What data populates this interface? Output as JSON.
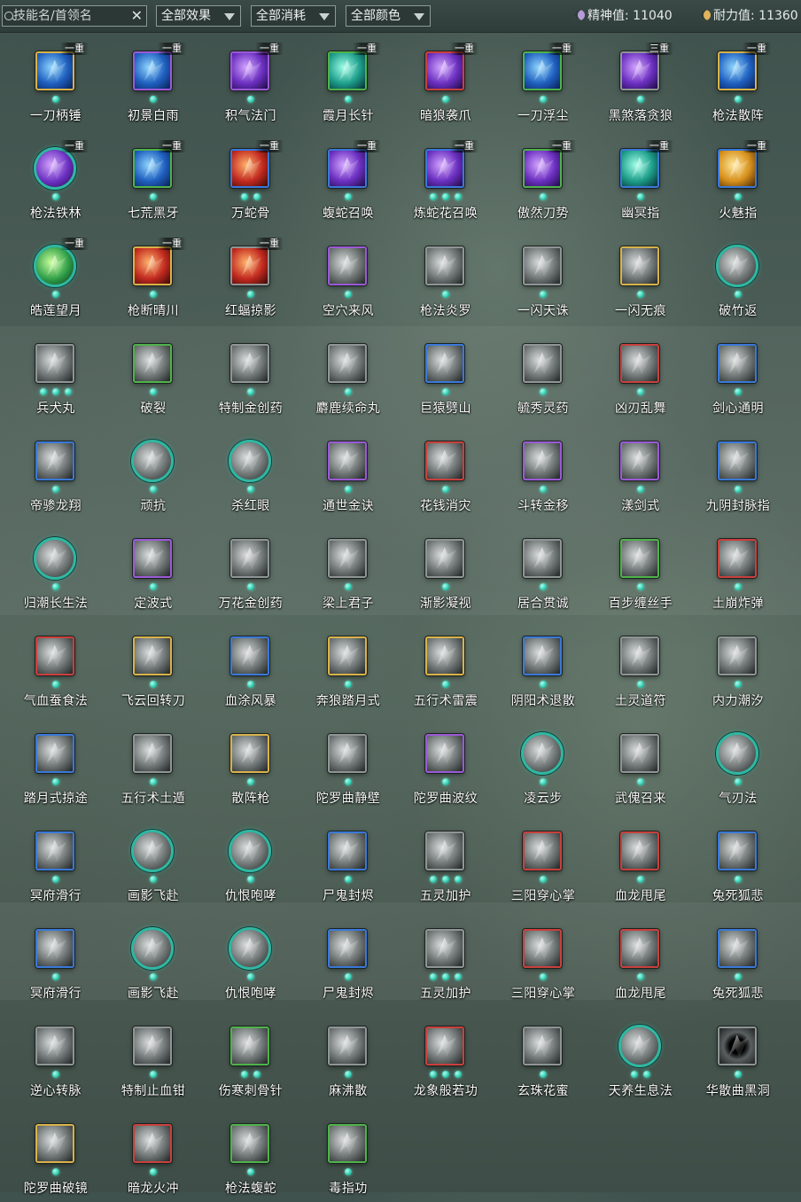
{
  "toolbar": {
    "search_placeholder": "技能名/首领名",
    "search_clear": "✕",
    "filters": [
      "全部效果",
      "全部消耗",
      "全部颜色"
    ],
    "stats": [
      {
        "label": "精神值: 11040",
        "icon": "spirit-moon-icon"
      },
      {
        "label": "耐力值: 11360",
        "icon": "stamina-moon-icon"
      }
    ]
  },
  "skills": [
    {
      "name": "一刀柄锤",
      "level": "一重",
      "dots": 1,
      "border": "gold",
      "palette": "blue",
      "shape": "square"
    },
    {
      "name": "初景白雨",
      "level": "一重",
      "dots": 1,
      "border": "purple",
      "palette": "blue",
      "shape": "square"
    },
    {
      "name": "积气法门",
      "level": "一重",
      "dots": 1,
      "border": "purple",
      "palette": "violet",
      "shape": "square"
    },
    {
      "name": "霞月长针",
      "level": "一重",
      "dots": 1,
      "border": "green",
      "palette": "cyan",
      "shape": "square"
    },
    {
      "name": "暗狼袭爪",
      "level": "一重",
      "dots": 1,
      "border": "red",
      "palette": "violet",
      "shape": "square"
    },
    {
      "name": "一刀浮尘",
      "level": "一重",
      "dots": 1,
      "border": "green",
      "palette": "blue",
      "shape": "square"
    },
    {
      "name": "黑煞落贪狼",
      "level": "三重",
      "dots": 1,
      "border": "gray",
      "palette": "violet",
      "shape": "square"
    },
    {
      "name": "枪法散阵",
      "level": "一重",
      "dots": 1,
      "border": "gold",
      "palette": "blue",
      "shape": "square"
    },
    {
      "name": "枪法铁林",
      "level": "一重",
      "dots": 1,
      "border": "round",
      "palette": "violet",
      "shape": "round"
    },
    {
      "name": "七荒黑牙",
      "level": "一重",
      "dots": 1,
      "border": "green",
      "palette": "blue",
      "shape": "square"
    },
    {
      "name": "万蛇骨",
      "level": "一重",
      "dots": 2,
      "border": "blue",
      "palette": "red",
      "shape": "square"
    },
    {
      "name": "蝮蛇召唤",
      "level": "一重",
      "dots": 1,
      "border": "blue",
      "palette": "violet",
      "shape": "square"
    },
    {
      "name": "炼蛇花召唤",
      "level": "一重",
      "dots": 3,
      "border": "blue",
      "palette": "violet",
      "shape": "square"
    },
    {
      "name": "傲然刀势",
      "level": "一重",
      "dots": 1,
      "border": "green",
      "palette": "violet",
      "shape": "square"
    },
    {
      "name": "幽冥指",
      "level": "一重",
      "dots": 1,
      "border": "blue",
      "palette": "cyan",
      "shape": "square"
    },
    {
      "name": "火魅指",
      "level": "一重",
      "dots": 1,
      "border": "blue",
      "palette": "gold",
      "shape": "square"
    },
    {
      "name": "皓莲望月",
      "level": "一重",
      "dots": 1,
      "border": "round",
      "palette": "green",
      "shape": "round"
    },
    {
      "name": "枪断晴川",
      "level": "一重",
      "dots": 1,
      "border": "gold",
      "palette": "red",
      "shape": "square"
    },
    {
      "name": "红蝠掠影",
      "level": "一重",
      "dots": 1,
      "border": "gray",
      "palette": "red",
      "shape": "square"
    },
    {
      "name": "空穴来风",
      "level": "",
      "dots": 1,
      "border": "purple",
      "palette": "gray",
      "shape": "square"
    },
    {
      "name": "枪法炎罗",
      "level": "",
      "dots": 1,
      "border": "gray",
      "palette": "gray",
      "shape": "square"
    },
    {
      "name": "一闪天诛",
      "level": "",
      "dots": 1,
      "border": "gray",
      "palette": "gray",
      "shape": "square"
    },
    {
      "name": "一闪无痕",
      "level": "",
      "dots": 1,
      "border": "gold",
      "palette": "gray",
      "shape": "square"
    },
    {
      "name": "破竹返",
      "level": "",
      "dots": 1,
      "border": "round",
      "palette": "gray",
      "shape": "round"
    },
    {
      "name": "兵犬丸",
      "level": "",
      "dots": 3,
      "border": "gray",
      "palette": "gray",
      "shape": "square"
    },
    {
      "name": "破裂",
      "level": "",
      "dots": 1,
      "border": "green",
      "palette": "gray",
      "shape": "square"
    },
    {
      "name": "特制金创药",
      "level": "",
      "dots": 1,
      "border": "gray",
      "palette": "gray",
      "shape": "square"
    },
    {
      "name": "麝鹿续命丸",
      "level": "",
      "dots": 1,
      "border": "gray",
      "palette": "gray",
      "shape": "square"
    },
    {
      "name": "巨猿劈山",
      "level": "",
      "dots": 1,
      "border": "blue",
      "palette": "gray",
      "shape": "square"
    },
    {
      "name": "毓秀灵药",
      "level": "",
      "dots": 1,
      "border": "gray",
      "palette": "gray",
      "shape": "square"
    },
    {
      "name": "凶刃乱舞",
      "level": "",
      "dots": 1,
      "border": "red",
      "palette": "gray",
      "shape": "square"
    },
    {
      "name": "剑心通明",
      "level": "",
      "dots": 1,
      "border": "blue",
      "palette": "gray",
      "shape": "square"
    },
    {
      "name": "帝骖龙翔",
      "level": "",
      "dots": 1,
      "border": "blue",
      "palette": "gray",
      "shape": "square"
    },
    {
      "name": "顽抗",
      "level": "",
      "dots": 1,
      "border": "round",
      "palette": "gray",
      "shape": "round"
    },
    {
      "name": "杀红眼",
      "level": "",
      "dots": 1,
      "border": "round",
      "palette": "gray",
      "shape": "round"
    },
    {
      "name": "通世金诀",
      "level": "",
      "dots": 1,
      "border": "purple",
      "palette": "gray",
      "shape": "square"
    },
    {
      "name": "花钱消灾",
      "level": "",
      "dots": 1,
      "border": "red",
      "palette": "gray",
      "shape": "square"
    },
    {
      "name": "斗转金移",
      "level": "",
      "dots": 1,
      "border": "purple",
      "palette": "gray",
      "shape": "square"
    },
    {
      "name": "漾剑式",
      "level": "",
      "dots": 1,
      "border": "purple",
      "palette": "gray",
      "shape": "square"
    },
    {
      "name": "九阴封脉指",
      "level": "",
      "dots": 1,
      "border": "blue",
      "palette": "gray",
      "shape": "square"
    },
    {
      "name": "归潮长生法",
      "level": "",
      "dots": 1,
      "border": "round",
      "palette": "gray",
      "shape": "round"
    },
    {
      "name": "定波式",
      "level": "",
      "dots": 1,
      "border": "purple",
      "palette": "gray",
      "shape": "square"
    },
    {
      "name": "万花金创药",
      "level": "",
      "dots": 1,
      "border": "gray",
      "palette": "gray",
      "shape": "square"
    },
    {
      "name": "梁上君子",
      "level": "",
      "dots": 1,
      "border": "gray",
      "palette": "gray",
      "shape": "square"
    },
    {
      "name": "渐影凝视",
      "level": "",
      "dots": 1,
      "border": "gray",
      "palette": "gray",
      "shape": "square"
    },
    {
      "name": "居合贯诚",
      "level": "",
      "dots": 1,
      "border": "gray",
      "palette": "gray",
      "shape": "square"
    },
    {
      "name": "百步缠丝手",
      "level": "",
      "dots": 1,
      "border": "green",
      "palette": "gray",
      "shape": "square"
    },
    {
      "name": "土崩炸弹",
      "level": "",
      "dots": 1,
      "border": "red",
      "palette": "gray",
      "shape": "square"
    },
    {
      "name": "气血蚕食法",
      "level": "",
      "dots": 1,
      "border": "red",
      "palette": "gray",
      "shape": "square"
    },
    {
      "name": "飞云回转刀",
      "level": "",
      "dots": 1,
      "border": "gold",
      "palette": "gray",
      "shape": "square"
    },
    {
      "name": "血涂风暴",
      "level": "",
      "dots": 1,
      "border": "blue",
      "palette": "gray",
      "shape": "square"
    },
    {
      "name": "奔狼踏月式",
      "level": "",
      "dots": 1,
      "border": "gold",
      "palette": "gray",
      "shape": "square"
    },
    {
      "name": "五行术雷震",
      "level": "",
      "dots": 1,
      "border": "gold",
      "palette": "gray",
      "shape": "square"
    },
    {
      "name": "阴阳术退散",
      "level": "",
      "dots": 1,
      "border": "blue",
      "palette": "gray",
      "shape": "square"
    },
    {
      "name": "土灵道符",
      "level": "",
      "dots": 1,
      "border": "gray",
      "palette": "gray",
      "shape": "square"
    },
    {
      "name": "内力潮汐",
      "level": "",
      "dots": 1,
      "border": "gray",
      "palette": "gray",
      "shape": "square"
    },
    {
      "name": "踏月式掠途",
      "level": "",
      "dots": 1,
      "border": "blue",
      "palette": "gray",
      "shape": "square"
    },
    {
      "name": "五行术土遁",
      "level": "",
      "dots": 1,
      "border": "gray",
      "palette": "gray",
      "shape": "square"
    },
    {
      "name": "散阵枪",
      "level": "",
      "dots": 1,
      "border": "gold",
      "palette": "gray",
      "shape": "square"
    },
    {
      "name": "陀罗曲静壁",
      "level": "",
      "dots": 1,
      "border": "gray",
      "palette": "gray",
      "shape": "square"
    },
    {
      "name": "陀罗曲波纹",
      "level": "",
      "dots": 1,
      "border": "purple",
      "palette": "gray",
      "shape": "square"
    },
    {
      "name": "凌云步",
      "level": "",
      "dots": 1,
      "border": "round",
      "palette": "gray",
      "shape": "round"
    },
    {
      "name": "武傀召来",
      "level": "",
      "dots": 1,
      "border": "gray",
      "palette": "gray",
      "shape": "square"
    },
    {
      "name": "气刃法",
      "level": "",
      "dots": 1,
      "border": "round",
      "palette": "gray",
      "shape": "round"
    },
    {
      "name": "冥府滑行",
      "level": "",
      "dots": 1,
      "border": "blue",
      "palette": "gray",
      "shape": "square"
    },
    {
      "name": "画影飞赴",
      "level": "",
      "dots": 1,
      "border": "round",
      "palette": "gray",
      "shape": "round"
    },
    {
      "name": "仇恨咆哮",
      "level": "",
      "dots": 1,
      "border": "round",
      "palette": "gray",
      "shape": "round"
    },
    {
      "name": "尸鬼封烬",
      "level": "",
      "dots": 1,
      "border": "blue",
      "palette": "gray",
      "shape": "square"
    },
    {
      "name": "五灵加护",
      "level": "",
      "dots": 3,
      "border": "gray",
      "palette": "gray",
      "shape": "square"
    },
    {
      "name": "三阳穿心掌",
      "level": "",
      "dots": 1,
      "border": "red",
      "palette": "gray",
      "shape": "square"
    },
    {
      "name": "血龙甩尾",
      "level": "",
      "dots": 1,
      "border": "red",
      "palette": "gray",
      "shape": "square"
    },
    {
      "name": "兔死狐悲",
      "level": "",
      "dots": 1,
      "border": "blue",
      "palette": "gray",
      "shape": "square"
    },
    {
      "name": "冥府滑行",
      "level": "",
      "dots": 1,
      "border": "blue",
      "palette": "gray",
      "shape": "square"
    },
    {
      "name": "画影飞赴",
      "level": "",
      "dots": 1,
      "border": "round",
      "palette": "gray",
      "shape": "round"
    },
    {
      "name": "仇恨咆哮",
      "level": "",
      "dots": 1,
      "border": "round",
      "palette": "gray",
      "shape": "round"
    },
    {
      "name": "尸鬼封烬",
      "level": "",
      "dots": 1,
      "border": "blue",
      "palette": "gray",
      "shape": "square"
    },
    {
      "name": "五灵加护",
      "level": "",
      "dots": 3,
      "border": "gray",
      "palette": "gray",
      "shape": "square"
    },
    {
      "name": "三阳穿心掌",
      "level": "",
      "dots": 1,
      "border": "red",
      "palette": "gray",
      "shape": "square"
    },
    {
      "name": "血龙甩尾",
      "level": "",
      "dots": 1,
      "border": "red",
      "palette": "gray",
      "shape": "square"
    },
    {
      "name": "兔死狐悲",
      "level": "",
      "dots": 1,
      "border": "blue",
      "palette": "gray",
      "shape": "square"
    },
    {
      "name": "逆心转脉",
      "level": "",
      "dots": 1,
      "border": "gray",
      "palette": "gray",
      "shape": "square"
    },
    {
      "name": "特制止血钳",
      "level": "",
      "dots": 1,
      "border": "gray",
      "palette": "gray",
      "shape": "square"
    },
    {
      "name": "伤寒刺骨针",
      "level": "",
      "dots": 2,
      "border": "green",
      "palette": "gray",
      "shape": "square"
    },
    {
      "name": "麻沸散",
      "level": "",
      "dots": 1,
      "border": "gray",
      "palette": "gray",
      "shape": "square"
    },
    {
      "name": "龙象般若功",
      "level": "",
      "dots": 3,
      "border": "red",
      "palette": "gray",
      "shape": "square"
    },
    {
      "name": "玄珠花蜜",
      "level": "",
      "dots": 1,
      "border": "gray",
      "palette": "gray",
      "shape": "square"
    },
    {
      "name": "天养生息法",
      "level": "",
      "dots": 2,
      "border": "round",
      "palette": "gray",
      "shape": "round"
    },
    {
      "name": "华散曲黑洞",
      "level": "",
      "dots": 1,
      "border": "gray",
      "palette": "dark",
      "shape": "square"
    },
    {
      "name": "陀罗曲破镜",
      "level": "",
      "dots": 1,
      "border": "gold",
      "palette": "gray",
      "shape": "square"
    },
    {
      "name": "暗龙火冲",
      "level": "",
      "dots": 1,
      "border": "red",
      "palette": "gray",
      "shape": "square"
    },
    {
      "name": "枪法蝮蛇",
      "level": "",
      "dots": 1,
      "border": "green",
      "palette": "gray",
      "shape": "square"
    },
    {
      "name": "毒指功",
      "level": "",
      "dots": 1,
      "border": "green",
      "palette": "gray",
      "shape": "square"
    }
  ]
}
